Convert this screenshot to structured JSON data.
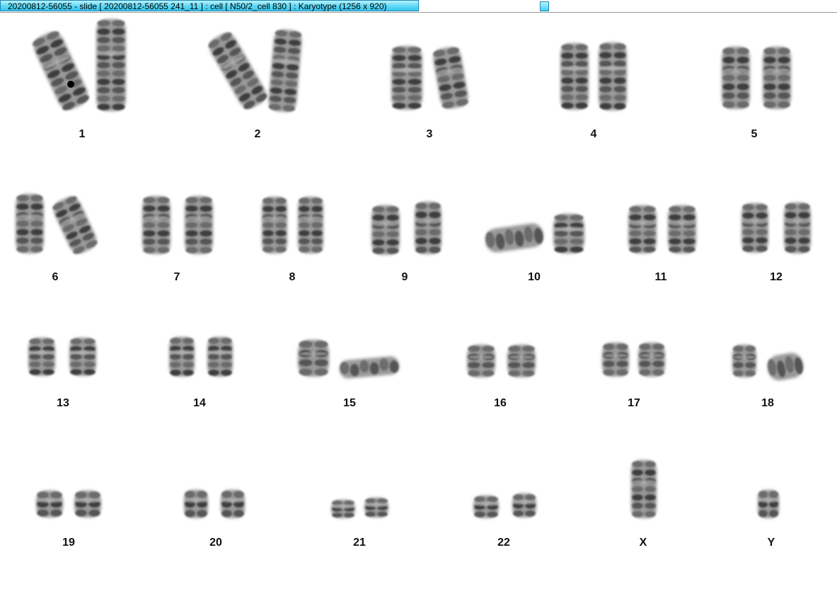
{
  "window": {
    "title": "20200812-56055 - slide [ 20200812-56055 241_11 ] : cell [ N50/2_cell 830 ] : Karyotype  (1256 x 920)"
  },
  "karyotype": {
    "chromosomes": [
      {
        "label": "1"
      },
      {
        "label": "2"
      },
      {
        "label": "3"
      },
      {
        "label": "4"
      },
      {
        "label": "5"
      },
      {
        "label": "6"
      },
      {
        "label": "7"
      },
      {
        "label": "8"
      },
      {
        "label": "9"
      },
      {
        "label": "10"
      },
      {
        "label": "11"
      },
      {
        "label": "12"
      },
      {
        "label": "13"
      },
      {
        "label": "14"
      },
      {
        "label": "15"
      },
      {
        "label": "16"
      },
      {
        "label": "17"
      },
      {
        "label": "18"
      },
      {
        "label": "19"
      },
      {
        "label": "20"
      },
      {
        "label": "21"
      },
      {
        "label": "22"
      },
      {
        "label": "X"
      },
      {
        "label": "Y"
      }
    ]
  }
}
